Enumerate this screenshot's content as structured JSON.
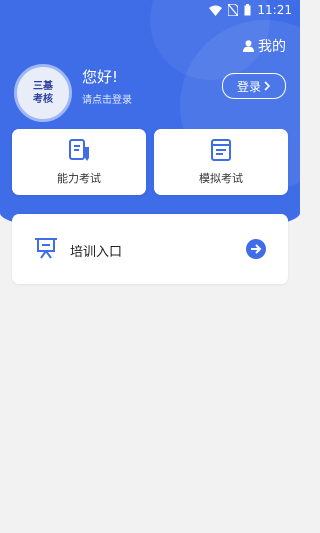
{
  "status_bar": {
    "time": "11:21"
  },
  "header": {
    "mine_label": "我的"
  },
  "profile": {
    "logo_text_line1": "三基",
    "logo_text_line2": "考核",
    "greeting": "您好!",
    "subtext": "请点击登录",
    "login_label": "登录"
  },
  "cards": [
    {
      "label": "能力考试",
      "icon": "document-pen-icon"
    },
    {
      "label": "模拟考试",
      "icon": "document-lines-icon"
    }
  ],
  "training": {
    "label": "培训入口",
    "icon": "presentation-board-icon"
  },
  "colors": {
    "primary": "#3f6de8",
    "background": "#f2f2f2",
    "card": "#ffffff"
  }
}
